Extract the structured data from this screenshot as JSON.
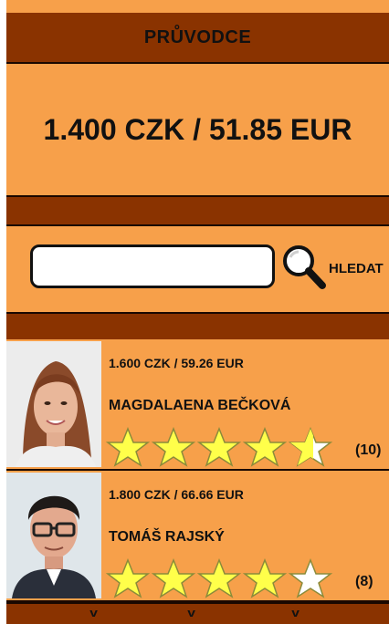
{
  "header": {
    "title": "PRŮVODCE"
  },
  "summary": {
    "price": "1.400 CZK / 51.85 EUR"
  },
  "search": {
    "value": "",
    "placeholder": "",
    "button_label": "HLEDAT"
  },
  "guides": [
    {
      "price": "1.600 CZK / 59.26 EUR",
      "name": "MAGDALAENA BEČKOVÁ",
      "rating": 4.5,
      "reviews": "(10)"
    },
    {
      "price": "1.800 CZK / 66.66 EUR",
      "name": "TOMÁŠ RAJSKÝ",
      "rating": 4,
      "reviews": "(8)"
    }
  ],
  "footer": {
    "chevrons": [
      "v",
      "v",
      "v"
    ]
  },
  "colors": {
    "bar": "#8a3300",
    "panel": "#f7a04a",
    "star": "#ffff4a",
    "text": "#111111"
  }
}
